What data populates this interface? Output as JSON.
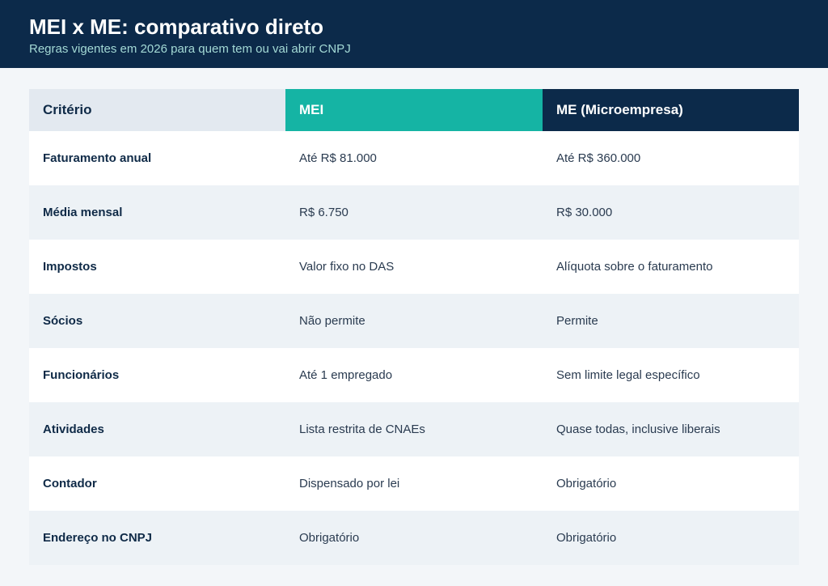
{
  "header": {
    "title": "MEI x ME: comparativo direto",
    "subtitle": "Regras vigentes em 2026 para quem tem ou vai abrir CNPJ"
  },
  "table": {
    "columns": [
      "Critério",
      "MEI",
      "ME (Microempresa)"
    ],
    "rows": [
      {
        "criterion": "Faturamento anual",
        "mei": "Até R$ 81.000",
        "me": "Até R$ 360.000"
      },
      {
        "criterion": "Média mensal",
        "mei": "R$ 6.750",
        "me": "R$ 30.000"
      },
      {
        "criterion": "Impostos",
        "mei": "Valor fixo no DAS",
        "me": "Alíquota sobre o faturamento"
      },
      {
        "criterion": "Sócios",
        "mei": "Não permite",
        "me": "Permite"
      },
      {
        "criterion": "Funcionários",
        "mei": "Até 1 empregado",
        "me": "Sem limite legal específico"
      },
      {
        "criterion": "Atividades",
        "mei": "Lista restrita de CNAEs",
        "me": "Quase todas, inclusive liberais"
      },
      {
        "criterion": "Contador",
        "mei": "Dispensado por lei",
        "me": "Obrigatório"
      },
      {
        "criterion": "Endereço no CNPJ",
        "mei": "Obrigatório",
        "me": "Obrigatório"
      }
    ]
  },
  "colors": {
    "header_bg": "#0c2a4a",
    "mei_accent": "#15b4a4",
    "me_accent": "#0c2a4a",
    "subtitle": "#a3d9d5",
    "row_alt": "#edf2f6"
  }
}
